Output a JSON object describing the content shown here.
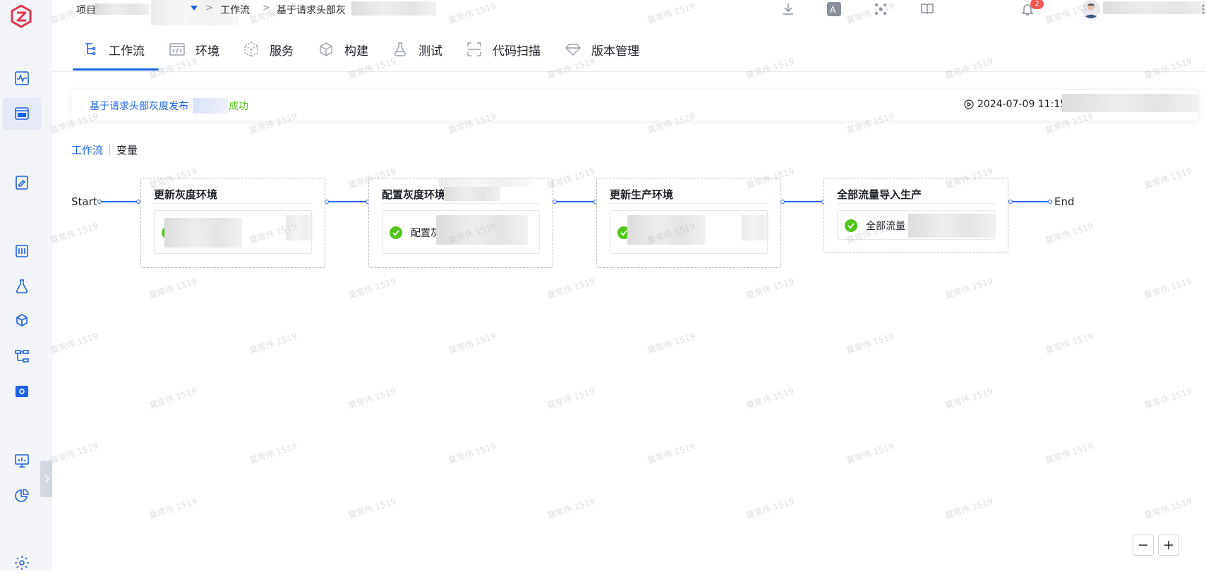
{
  "breadcrumb": {
    "project_label": "项目",
    "workflow_label": "工作流",
    "current_label": "基于请求头部灰",
    "separator": ">"
  },
  "topbar": {
    "notification_count": "2"
  },
  "tabs": [
    {
      "label": "工作流",
      "icon": "workflow-icon"
    },
    {
      "label": "环境",
      "icon": "code-icon"
    },
    {
      "label": "服务",
      "icon": "cube-icon"
    },
    {
      "label": "构建",
      "icon": "hexagon-icon"
    },
    {
      "label": "测试",
      "icon": "flask-icon"
    },
    {
      "label": "代码扫描",
      "icon": "scan-icon"
    },
    {
      "label": "版本管理",
      "icon": "diamond-icon"
    }
  ],
  "status": {
    "workflow_name": "基于请求头部灰度发布",
    "result": "成功",
    "start_time": "2024-07-09 11:15"
  },
  "subtabs": {
    "workflow": "工作流",
    "variables": "变量"
  },
  "flow": {
    "start": "Start",
    "end": "End",
    "stages": [
      {
        "title": "更新灰度环境",
        "job": ""
      },
      {
        "title": "配置灰度环境",
        "job": "配置灰"
      },
      {
        "title": "更新生产环境",
        "job": ""
      },
      {
        "title": "全部流量导入生产",
        "job": "全部流量"
      }
    ]
  },
  "watermark": "莫常伟 1519",
  "colors": {
    "accent": "#1e64e6",
    "success": "#52c41a",
    "badge": "#f4584f"
  }
}
